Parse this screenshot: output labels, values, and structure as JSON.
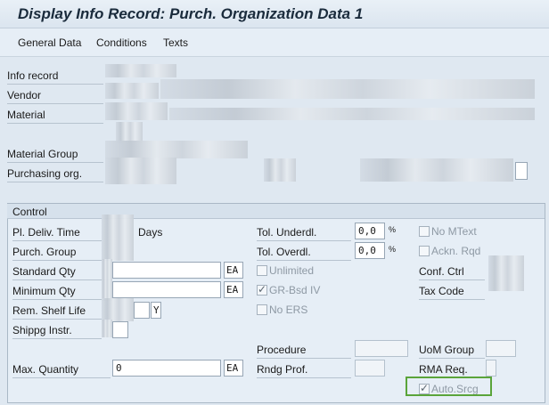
{
  "window": {
    "title": "Display Info Record: Purch. Organization Data 1"
  },
  "toolbar": {
    "general_data": "General Data",
    "conditions": "Conditions",
    "texts": "Texts"
  },
  "header": {
    "info_record_label": "Info record",
    "vendor_label": "Vendor",
    "material_label": "Material",
    "material_group_label": "Material Group",
    "purchasing_org_label": "Purchasing org."
  },
  "control": {
    "title": "Control",
    "pl_deliv_time_label": "Pl. Deliv. Time",
    "pl_deliv_time_unit": "Days",
    "purch_group_label": "Purch. Group",
    "standard_qty_label": "Standard Qty",
    "standard_qty_unit": "EA",
    "minimum_qty_label": "Minimum Qty",
    "minimum_qty_unit": "EA",
    "rem_shelf_life_label": "Rem. Shelf Life",
    "rem_shelf_life_unit": "Y",
    "shippg_instr_label": "Shippg Instr.",
    "max_quantity_label": "Max. Quantity",
    "max_quantity_value": "0",
    "max_quantity_unit": "EA",
    "tol_underdl_label": "Tol. Underdl.",
    "tol_underdl_value": "0,0",
    "tol_overdl_label": "Tol. Overdl.",
    "tol_overdl_value": "0,0",
    "percent_symbol": "%",
    "unlimited_label": "Unlimited",
    "gr_bsd_iv_label": "GR-Bsd IV",
    "no_ers_label": "No ERS",
    "procedure_label": "Procedure",
    "rndg_prof_label": "Rndg Prof.",
    "no_mtext_label": "No MText",
    "ackn_rqd_label": "Ackn. Rqd",
    "conf_ctrl_label": "Conf. Ctrl",
    "tax_code_label": "Tax Code",
    "uom_group_label": "UoM Group",
    "rma_req_label": "RMA Req.",
    "auto_srcg_label": "Auto.Srcg"
  },
  "colors": {
    "highlight": "#5aa43a",
    "background": "#dfe8f1"
  }
}
